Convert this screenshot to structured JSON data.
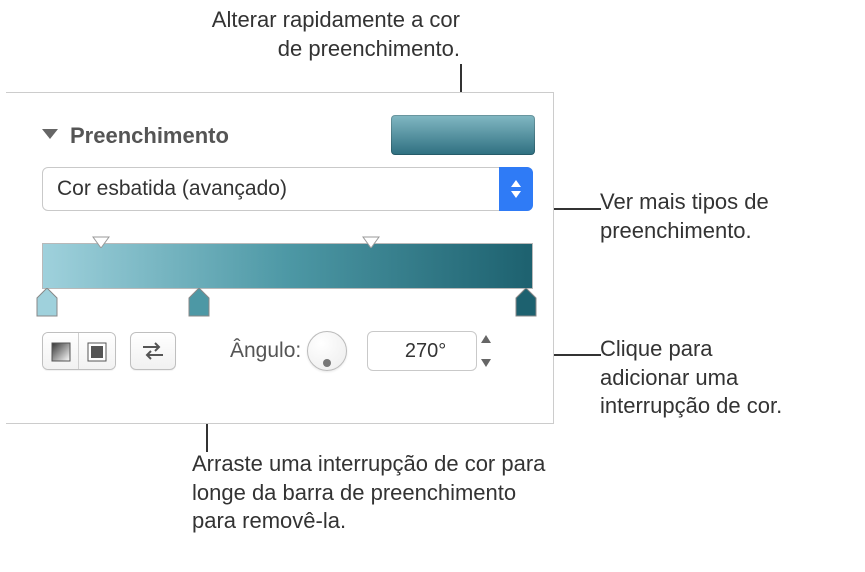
{
  "callouts": {
    "quick_color": "Alterar rapidamente a cor\nde preenchimento.",
    "more_types": "Ver mais tipos de\npreenchimento.",
    "add_stop": "Clique para\nadicionar uma\ninterrupção de cor.",
    "remove_stop": "Arraste uma interrupção de cor para\nlonge da barra de preenchimento\npara removê-la."
  },
  "panel": {
    "section_title": "Preenchimento",
    "fill_type": "Cor esbatida (avançado)",
    "swatch_gradient": [
      "#82b8c3",
      "#2e6f80"
    ],
    "gradient_stops": [
      {
        "position": 0.01,
        "color": "#9fd1dc"
      },
      {
        "position": 0.32,
        "color": "#4d98a5"
      },
      {
        "position": 0.985,
        "color": "#1d616f"
      }
    ],
    "top_handles": [
      0.12,
      0.67
    ],
    "angle_label": "Ângulo:",
    "angle_value": "270°"
  },
  "icons": {
    "disclosure": "chevron-down-icon",
    "select_arrows": "up-down-arrows-icon",
    "linear_mode": "linear-gradient-icon",
    "radial_mode": "radial-gradient-icon",
    "flip": "swap-arrows-icon",
    "stepper_up": "stepper-up-icon",
    "stepper_down": "stepper-down-icon"
  }
}
